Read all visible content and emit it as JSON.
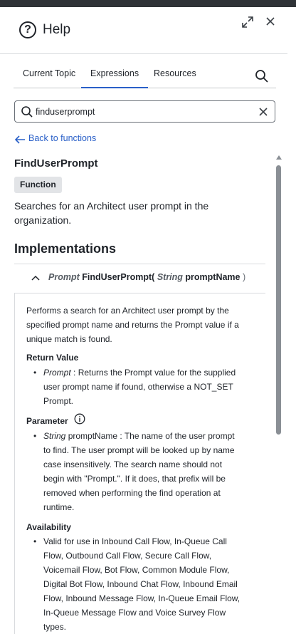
{
  "header": {
    "title": "Help"
  },
  "tabs": [
    {
      "label": "Current Topic"
    },
    {
      "label": "Expressions"
    },
    {
      "label": "Resources"
    }
  ],
  "search": {
    "value": "finduserprompt",
    "placeholder": ""
  },
  "back_link": "Back to functions",
  "function": {
    "name": "FindUserPrompt",
    "badge": "Function",
    "description": "Searches for an Architect user prompt in the organization."
  },
  "implementations": {
    "title": "Implementations",
    "signature": {
      "return_type": "Prompt",
      "name": "FindUserPrompt(",
      "param_type": "String",
      "param_name": "promptName",
      "close": ")"
    },
    "detail": "Performs a search for an Architect user prompt by the specified prompt name and returns the Prompt value if a unique match is found.",
    "return_value": {
      "heading": "Return Value",
      "type": "Prompt",
      "text": " : Returns the Prompt value for the supplied user prompt name if found, otherwise a NOT_SET Prompt."
    },
    "parameter": {
      "heading": "Parameter",
      "type": "String",
      "text": "  promptName : The name of the user prompt to find. The user prompt will be looked up by name case insensitively. The search name should not begin with \"Prompt.\". If it does, that prefix will be removed when performing the find operation at runtime."
    },
    "availability": {
      "heading": "Availability",
      "text": "Valid for use in Inbound Call Flow, In-Queue Call Flow, Outbound Call Flow, Secure Call Flow, Voicemail Flow, Bot Flow, Common Module Flow, Digital Bot Flow, Inbound Chat Flow, Inbound Email Flow, Inbound Message Flow, In-Queue Email Flow, In-Queue Message Flow and Voice Survey Flow types."
    }
  },
  "icons": {
    "help": "question-circle-icon",
    "expand": "expand-icon",
    "close": "close-icon",
    "search": "search-icon",
    "clear": "clear-icon",
    "back": "arrow-left-icon",
    "collapse": "chevron-up-icon",
    "info": "info-icon"
  },
  "colors": {
    "accent": "#2a60c8",
    "text": "#1f2329",
    "badge_bg": "#e2e4e7",
    "scrollbar": "#8a8f95"
  }
}
